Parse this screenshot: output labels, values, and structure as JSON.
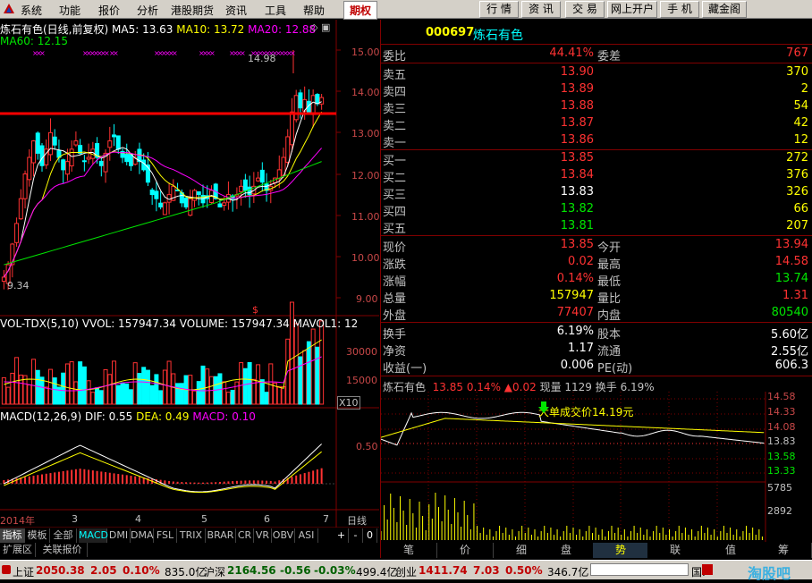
{
  "menu": {
    "items": [
      "系统",
      "功能",
      "报价",
      "分析",
      "港股期货",
      "资讯",
      "工具",
      "帮助"
    ],
    "active": "期权",
    "right_buttons": [
      "行 情",
      "资 讯",
      "交 易",
      "网上开户",
      "手 机",
      "藏金阁"
    ]
  },
  "kline": {
    "title": "炼石有色(日线,前复权)",
    "ma5": "MA5: 13.63",
    "ma10": "MA10: 13.72",
    "ma20": "MA20: 12.88",
    "ma60": "MA60: 12.15",
    "high_label": "14.98",
    "low_label": "9.34",
    "price_ticks": [
      "15.00",
      "14.00",
      "13.00",
      "12.00",
      "11.00",
      "10.00",
      "9.00"
    ],
    "dividend_mark": "$"
  },
  "volume": {
    "title": "VOL-TDX(5,10)",
    "vvol": "VVOL: 157947.34",
    "volume": "VOLUME: 157947.34",
    "mavol": "MAVOL1: 12",
    "ticks": [
      "30000",
      "15000"
    ],
    "unit": "X10"
  },
  "macd": {
    "title": "MACD(12,26,9)",
    "dif": "DIF: 0.55",
    "dea": "DEA: 0.49",
    "macd": "MACD: 0.10",
    "tick": "0.50"
  },
  "date_axis": {
    "labels": [
      "2014年",
      "3",
      "4",
      "5",
      "6",
      "7"
    ],
    "period": "日线"
  },
  "indicator_tabs": [
    "指标",
    "模板",
    "全部",
    "MACD",
    "DMI",
    "DMA",
    "FSL",
    "TRIX",
    "BRAR",
    "CR",
    "VR",
    "OBV",
    "ASI"
  ],
  "indicator_active": "MACD",
  "tab_controls": [
    "+",
    "-",
    "0"
  ],
  "bottom_left_tabs": [
    "扩展区",
    "关联报价"
  ],
  "quote": {
    "code": "000697",
    "name": "炼石有色",
    "weibi_label": "委比",
    "weibi": "44.41%",
    "weicha_label": "委差",
    "weicha": "767",
    "asks": [
      {
        "label": "卖五",
        "price": "13.90",
        "vol": "370"
      },
      {
        "label": "卖四",
        "price": "13.89",
        "vol": "2"
      },
      {
        "label": "卖三",
        "price": "13.88",
        "vol": "54"
      },
      {
        "label": "卖二",
        "price": "13.87",
        "vol": "42"
      },
      {
        "label": "卖一",
        "price": "13.86",
        "vol": "12"
      }
    ],
    "bids": [
      {
        "label": "买一",
        "price": "13.85",
        "vol": "272"
      },
      {
        "label": "买二",
        "price": "13.84",
        "vol": "376"
      },
      {
        "label": "买三",
        "price": "13.83",
        "vol": "326"
      },
      {
        "label": "买四",
        "price": "13.82",
        "vol": "66"
      },
      {
        "label": "买五",
        "price": "13.81",
        "vol": "207"
      }
    ],
    "stats": [
      {
        "l1": "现价",
        "v1": "13.85",
        "c1": "red",
        "l2": "今开",
        "v2": "13.94",
        "c2": "red"
      },
      {
        "l1": "涨跌",
        "v1": "0.02",
        "c1": "red",
        "l2": "最高",
        "v2": "14.58",
        "c2": "red"
      },
      {
        "l1": "涨幅",
        "v1": "0.14%",
        "c1": "red",
        "l2": "最低",
        "v2": "13.74",
        "c2": "green"
      },
      {
        "l1": "总量",
        "v1": "157947",
        "c1": "yellow",
        "l2": "量比",
        "v2": "1.31",
        "c2": "red"
      },
      {
        "l1": "外盘",
        "v1": "77407",
        "c1": "red",
        "l2": "内盘",
        "v2": "80540",
        "c2": "green"
      }
    ],
    "stats2": [
      {
        "l1": "换手",
        "v1": "6.19%",
        "l2": "股本",
        "v2": "5.60亿"
      },
      {
        "l1": "净资",
        "v1": "1.17",
        "l2": "流通",
        "v2": "2.55亿"
      },
      {
        "l1": "收益(一)",
        "v1": "0.006",
        "l2": "PE(动)",
        "v2": "606.3"
      }
    ]
  },
  "intraday": {
    "name": "炼石有色",
    "price": "13.85",
    "pct": "0.14%",
    "change": "▲0.02",
    "now_vol": "现量 1129",
    "turnover": "换手 6.19%",
    "price_ticks": [
      "14.58",
      "14.33",
      "14.08",
      "13.83",
      "13.58",
      "13.33"
    ],
    "vol_ticks": [
      "5785",
      "2892"
    ],
    "annotation": "大单成交价14.19元"
  },
  "right_tabs": [
    "笔",
    "价",
    "细",
    "盘",
    "势",
    "联",
    "值",
    "筹"
  ],
  "right_tab_active": "势",
  "status": {
    "idx1_name": "上证",
    "idx1_val": "2050.38",
    "idx1_chg": "2.05",
    "idx1_pct": "0.10%",
    "idx1_amt": "835.0亿",
    "idx2_name": "沪深",
    "idx2_val": "2164.56",
    "idx2_chg": "-0.56",
    "idx2_pct": "-0.03%",
    "idx2_amt": "499.4亿",
    "idx3_name": "创业",
    "idx3_val": "1411.74",
    "idx3_chg": "7.03",
    "idx3_pct": "0.50%",
    "idx3_amt": "346.7亿",
    "extra": "国.",
    "watermark": "淘股吧"
  },
  "colors": {
    "up": "#ff3232",
    "down": "#00e600",
    "ma5": "#ffffff",
    "ma10": "#ffff00",
    "ma20": "#ff00ff",
    "ma60": "#00e600",
    "support": "#ff0000"
  }
}
